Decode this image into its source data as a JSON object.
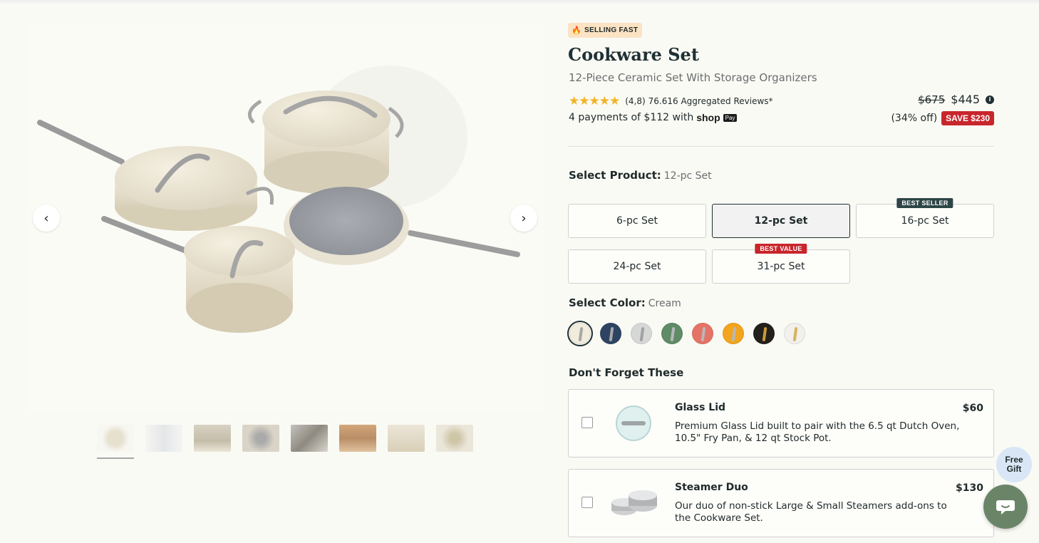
{
  "badge": {
    "text": "SELLING FAST",
    "icon": "fire-icon"
  },
  "product": {
    "title": "Cookware Set",
    "subtitle": "12-Piece Ceramic Set With Storage Organizers",
    "rating_value": "(4,8)",
    "rating_text": "76.616 Aggregated Reviews*",
    "rating_stars": 5,
    "payments_text": "4 payments of $112 with",
    "shop_logo": "shop",
    "shop_pay": "Pay",
    "price_old": "$675",
    "price_new": "$445",
    "discount": "(34% off)",
    "save_badge": "SAVE $230"
  },
  "select_product": {
    "label": "Select Product:",
    "value": "12-pc Set",
    "options": [
      {
        "label": "6-pc Set",
        "badge": ""
      },
      {
        "label": "12-pc Set",
        "badge": "",
        "selected": true
      },
      {
        "label": "16-pc Set",
        "badge": "BEST SELLER"
      },
      {
        "label": "24-pc Set",
        "badge": ""
      },
      {
        "label": "31-pc Set",
        "badge": "BEST VALUE"
      }
    ]
  },
  "select_color": {
    "label": "Select Color:",
    "value": "Cream",
    "swatches": [
      {
        "name": "cream",
        "color": "#f2ecdd",
        "handle": "#a8a8a8",
        "selected": true
      },
      {
        "name": "navy",
        "color": "#2e4361",
        "handle": "#a8a8a8"
      },
      {
        "name": "gray",
        "color": "#d6d7d7",
        "handle": "#a0a0a0"
      },
      {
        "name": "sage",
        "color": "#5f8b67",
        "handle": "#b8b8b8"
      },
      {
        "name": "perracotta",
        "color": "#e57367",
        "handle": "#b8b8b8"
      },
      {
        "name": "marigold",
        "color": "#f2a51d",
        "handle": "#b8b8b8"
      },
      {
        "name": "black",
        "color": "#231f1b",
        "handle": "#c79a3b"
      },
      {
        "name": "white",
        "color": "#f1f0ec",
        "handle": "#d7b35a"
      }
    ]
  },
  "addons": {
    "heading": "Don't Forget These",
    "items": [
      {
        "title": "Glass Lid",
        "price": "$60",
        "desc": "Premium Glass Lid built to pair with the 6.5 qt Dutch Oven, 10.5\" Fry Pan, & 12 qt Stock Pot."
      },
      {
        "title": "Steamer Duo",
        "price": "$130",
        "desc": "Our duo of non-stick Large & Small Steamers add-ons to the Cookware Set."
      }
    ]
  },
  "free_gift": {
    "line1": "Free",
    "line2": "Gift"
  },
  "colors": {
    "accent": "#1f3034",
    "save_red": "#c8262c",
    "best_seller_bg": "#2d4547",
    "best_value_bg": "#c8262c",
    "chat_bg": "#6a8468"
  }
}
